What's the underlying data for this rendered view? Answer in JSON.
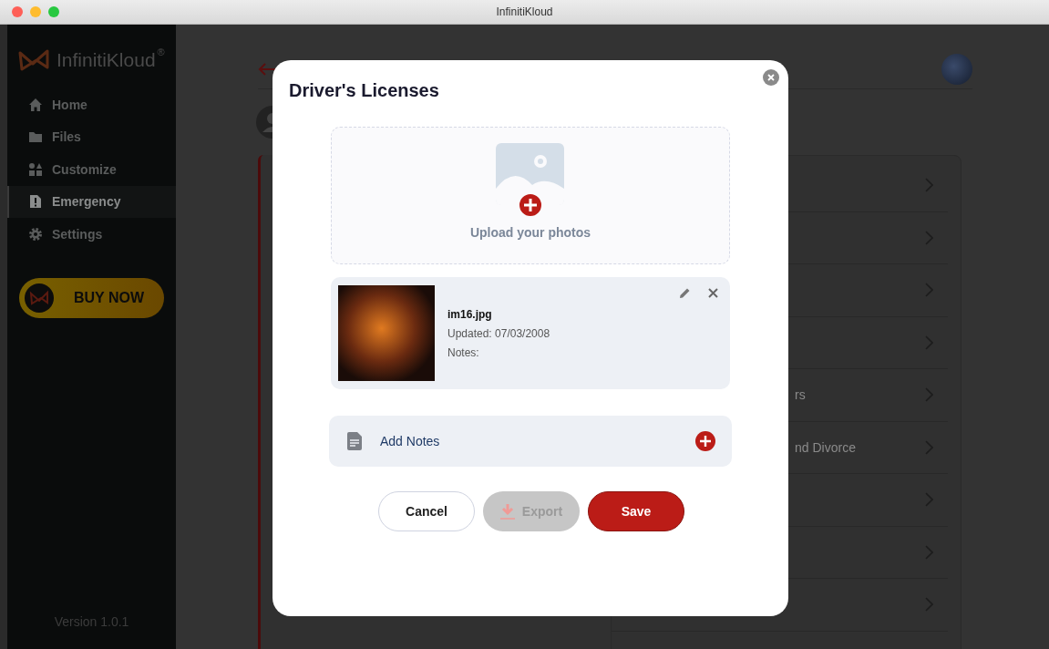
{
  "window": {
    "title": "InfinitiKloud"
  },
  "sidebar": {
    "logo": "InfinitiKloud",
    "logo_mark": "®",
    "items": [
      {
        "label": "Home",
        "selected": false
      },
      {
        "label": "Files",
        "selected": false
      },
      {
        "label": "Customize",
        "selected": false
      },
      {
        "label": "Emergency",
        "selected": true
      },
      {
        "label": "Settings",
        "selected": false
      }
    ],
    "buy_button": "BUY NOW",
    "version": "Version 1.0.1"
  },
  "background_list": {
    "rows": [
      {},
      {},
      {},
      {},
      {
        "label": "rs"
      },
      {
        "label": "nd Divorce"
      },
      {},
      {},
      {}
    ]
  },
  "modal": {
    "title": "Driver's Licenses",
    "upload": {
      "label": "Upload your photos"
    },
    "files": [
      {
        "name": "im16.jpg",
        "updated": "Updated: 07/03/2008",
        "notes": "Notes:"
      }
    ],
    "add_notes": {
      "label": "Add Notes"
    },
    "buttons": [
      {
        "label": "Cancel",
        "kind": "secondary",
        "disabled": false
      },
      {
        "label": "Export",
        "kind": "export",
        "disabled": true
      },
      {
        "label": "Save",
        "kind": "primary",
        "disabled": false
      }
    ]
  }
}
